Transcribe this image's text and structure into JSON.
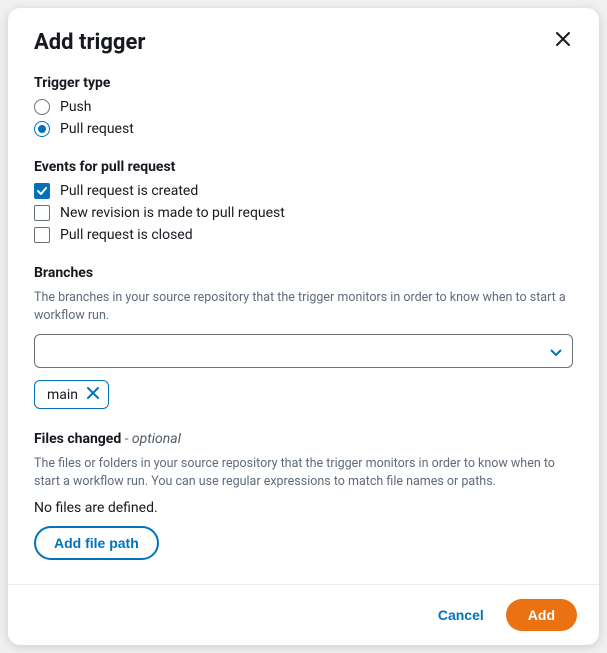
{
  "modal": {
    "title": "Add trigger"
  },
  "triggerType": {
    "label": "Trigger type",
    "options": {
      "push": "Push",
      "pullRequest": "Pull request"
    },
    "selected": "pullRequest"
  },
  "events": {
    "label": "Events for pull request",
    "options": {
      "created": {
        "label": "Pull request is created",
        "checked": true
      },
      "newRevision": {
        "label": "New revision is made to pull request",
        "checked": false
      },
      "closed": {
        "label": "Pull request is closed",
        "checked": false
      }
    }
  },
  "branches": {
    "label": "Branches",
    "hint": "The branches in your source repository that the trigger monitors in order to know when to start a workflow run.",
    "selectValue": "",
    "tags": [
      "main"
    ]
  },
  "filesChanged": {
    "label": "Files changed",
    "optional": "- optional",
    "hint": "The files or folders in your source repository that the trigger monitors in order to know when to start a workflow run. You can use regular expressions to match file names or paths.",
    "empty": "No files are defined.",
    "addButton": "Add file path"
  },
  "footer": {
    "cancel": "Cancel",
    "submit": "Add"
  }
}
